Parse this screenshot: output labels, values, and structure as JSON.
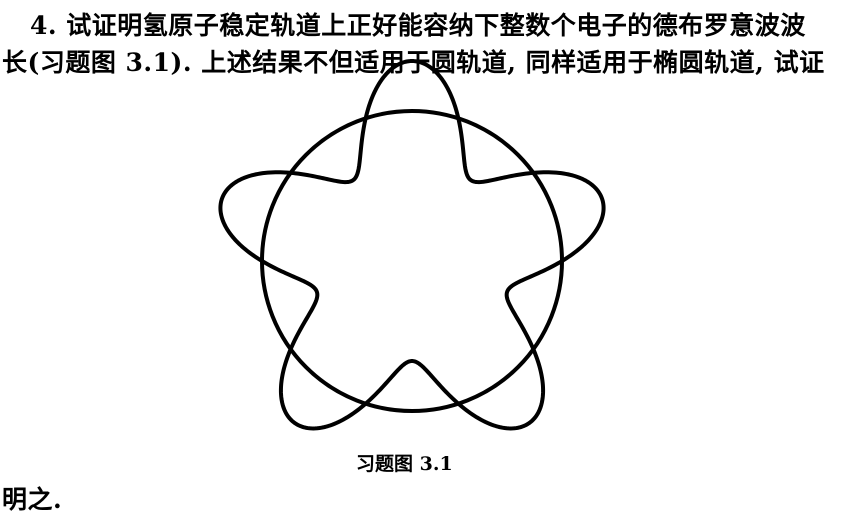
{
  "text": {
    "line1": "4. 试证明氢原子稳定轨道上正好能容纳下整数个电子的德布罗意波波",
    "line2": "长(习题图 3.1). 上述结果不但适用于圆轨道, 同样适用于椭圆轨道, 试证",
    "line3": "明之."
  },
  "figure": {
    "caption": "习题图 3.1",
    "standing_wave_crests": 5,
    "stroke_color": "#000000"
  }
}
